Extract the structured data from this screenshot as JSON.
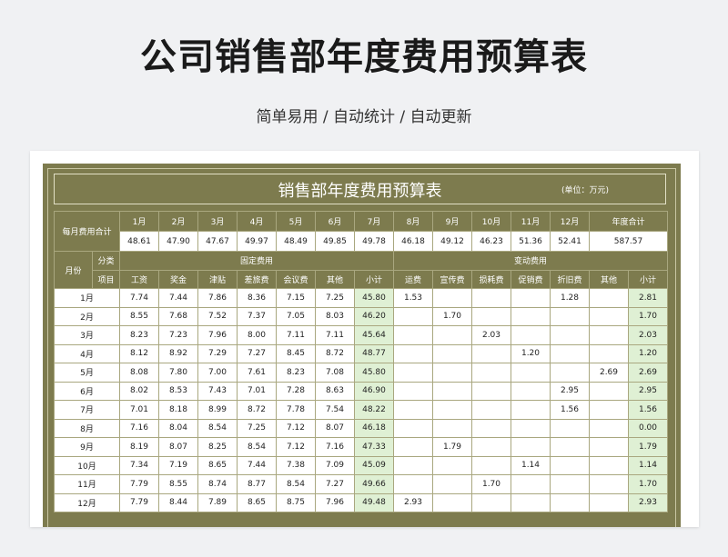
{
  "header": {
    "title": "公司销售部年度费用预算表",
    "subtitle": "简单易用  /  自动统计  /  自动更新"
  },
  "sheet": {
    "title": "销售部年度费用预算表",
    "unit_note": "(单位：万元)",
    "labels": {
      "monthly_total": "每月费用合计",
      "month": "月份",
      "category": "分类",
      "item": "项目",
      "fixed": "固定费用",
      "variable": "变动费用",
      "annual_total": "年度合计"
    },
    "monthly_header": [
      "1月",
      "2月",
      "3月",
      "4月",
      "5月",
      "6月",
      "7月",
      "8月",
      "9月",
      "10月",
      "11月",
      "12月"
    ],
    "monthly_totals": [
      "48.61",
      "47.90",
      "47.67",
      "49.97",
      "48.49",
      "49.85",
      "49.78",
      "46.18",
      "49.12",
      "46.23",
      "51.36",
      "52.41"
    ],
    "annual_total_value": "587.57",
    "fixed_items": [
      "工资",
      "奖金",
      "津贴",
      "差旅费",
      "会议费",
      "其他",
      "小计"
    ],
    "variable_items": [
      "运费",
      "宣传费",
      "损耗费",
      "促销费",
      "折旧费",
      "其他",
      "小计"
    ],
    "rows": [
      {
        "month": "1月",
        "fixed": [
          "7.74",
          "7.44",
          "7.86",
          "8.36",
          "7.15",
          "7.25",
          "45.80"
        ],
        "variable": [
          "1.53",
          "",
          "",
          "",
          "1.28",
          "",
          "2.81"
        ]
      },
      {
        "month": "2月",
        "fixed": [
          "8.55",
          "7.68",
          "7.52",
          "7.37",
          "7.05",
          "8.03",
          "46.20"
        ],
        "variable": [
          "",
          "1.70",
          "",
          "",
          "",
          "",
          "1.70"
        ]
      },
      {
        "month": "3月",
        "fixed": [
          "8.23",
          "7.23",
          "7.96",
          "8.00",
          "7.11",
          "7.11",
          "45.64"
        ],
        "variable": [
          "",
          "",
          "2.03",
          "",
          "",
          "",
          "2.03"
        ]
      },
      {
        "month": "4月",
        "fixed": [
          "8.12",
          "8.92",
          "7.29",
          "7.27",
          "8.45",
          "8.72",
          "48.77"
        ],
        "variable": [
          "",
          "",
          "",
          "1.20",
          "",
          "",
          "1.20"
        ]
      },
      {
        "month": "5月",
        "fixed": [
          "8.08",
          "7.80",
          "7.00",
          "7.61",
          "8.23",
          "7.08",
          "45.80"
        ],
        "variable": [
          "",
          "",
          "",
          "",
          "",
          "2.69",
          "2.69"
        ]
      },
      {
        "month": "6月",
        "fixed": [
          "8.02",
          "8.53",
          "7.43",
          "7.01",
          "7.28",
          "8.63",
          "46.90"
        ],
        "variable": [
          "",
          "",
          "",
          "",
          "2.95",
          "",
          "2.95"
        ]
      },
      {
        "month": "7月",
        "fixed": [
          "7.01",
          "8.18",
          "8.99",
          "8.72",
          "7.78",
          "7.54",
          "48.22"
        ],
        "variable": [
          "",
          "",
          "",
          "",
          "1.56",
          "",
          "1.56"
        ]
      },
      {
        "month": "8月",
        "fixed": [
          "7.16",
          "8.04",
          "8.54",
          "7.25",
          "7.12",
          "8.07",
          "46.18"
        ],
        "variable": [
          "",
          "",
          "",
          "",
          "",
          "",
          "0.00"
        ]
      },
      {
        "month": "9月",
        "fixed": [
          "8.19",
          "8.07",
          "8.25",
          "8.54",
          "7.12",
          "7.16",
          "47.33"
        ],
        "variable": [
          "",
          "1.79",
          "",
          "",
          "",
          "",
          "1.79"
        ]
      },
      {
        "month": "10月",
        "fixed": [
          "7.34",
          "7.19",
          "8.65",
          "7.44",
          "7.38",
          "7.09",
          "45.09"
        ],
        "variable": [
          "",
          "",
          "",
          "1.14",
          "",
          "",
          "1.14"
        ]
      },
      {
        "month": "11月",
        "fixed": [
          "7.79",
          "8.55",
          "8.74",
          "8.77",
          "8.54",
          "7.27",
          "49.66"
        ],
        "variable": [
          "",
          "",
          "1.70",
          "",
          "",
          "",
          "1.70"
        ]
      },
      {
        "month": "12月",
        "fixed": [
          "7.79",
          "8.44",
          "7.89",
          "8.65",
          "8.75",
          "7.96",
          "49.48"
        ],
        "variable": [
          "2.93",
          "",
          "",
          "",
          "",
          "",
          "2.93"
        ]
      }
    ]
  }
}
